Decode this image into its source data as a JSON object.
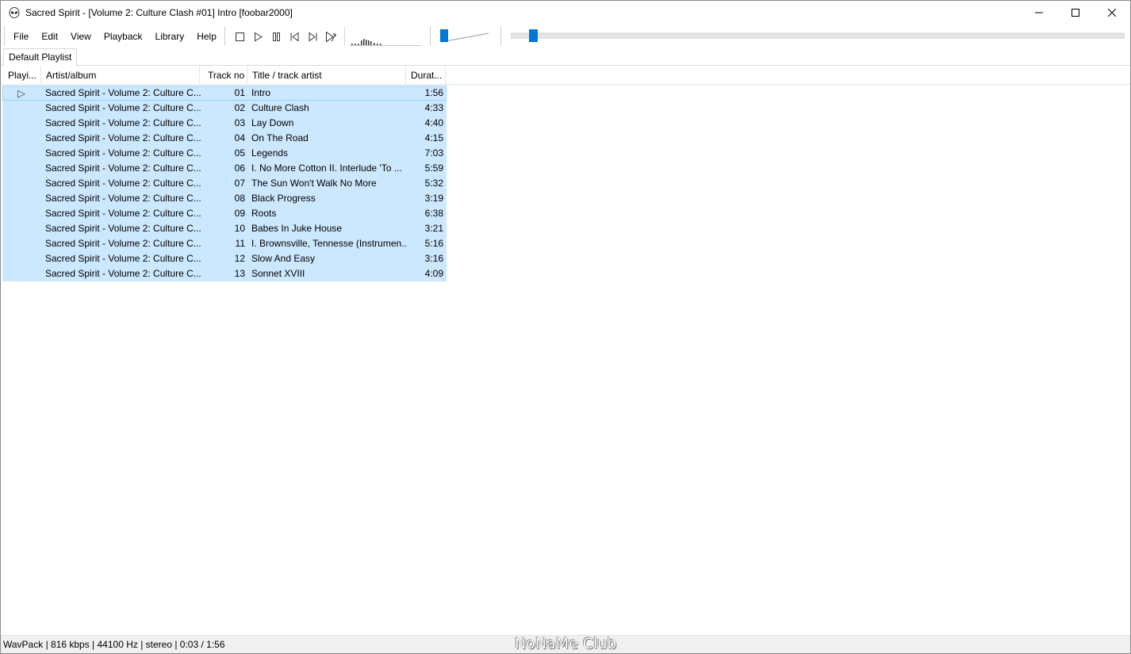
{
  "window": {
    "title": "Sacred Spirit - [Volume 2: Culture Clash #01] Intro  [foobar2000]"
  },
  "menu": [
    "File",
    "Edit",
    "View",
    "Playback",
    "Library",
    "Help"
  ],
  "transport_icons": [
    "stop-icon",
    "play-icon",
    "pause-icon",
    "previous-icon",
    "next-icon",
    "random-icon"
  ],
  "tabs": [
    "Default Playlist"
  ],
  "columns": {
    "playing": "Playi...",
    "artist_album": "Artist/album",
    "track_no": "Track no",
    "title_artist": "Title / track artist",
    "duration": "Durat..."
  },
  "rows": [
    {
      "playing": "▷",
      "artist": "Sacred Spirit - Volume 2: Culture C...",
      "track": "01",
      "title": "Intro",
      "duration": "1:56"
    },
    {
      "playing": "",
      "artist": "Sacred Spirit - Volume 2: Culture C...",
      "track": "02",
      "title": "Culture Clash",
      "duration": "4:33"
    },
    {
      "playing": "",
      "artist": "Sacred Spirit - Volume 2: Culture C...",
      "track": "03",
      "title": "Lay Down",
      "duration": "4:40"
    },
    {
      "playing": "",
      "artist": "Sacred Spirit - Volume 2: Culture C...",
      "track": "04",
      "title": "On The Road",
      "duration": "4:15"
    },
    {
      "playing": "",
      "artist": "Sacred Spirit - Volume 2: Culture C...",
      "track": "05",
      "title": "Legends",
      "duration": "7:03"
    },
    {
      "playing": "",
      "artist": "Sacred Spirit - Volume 2: Culture C...",
      "track": "06",
      "title": "I. No More Cotton II. Interlude 'To ...",
      "duration": "5:59"
    },
    {
      "playing": "",
      "artist": "Sacred Spirit - Volume 2: Culture C...",
      "track": "07",
      "title": "The Sun Won't Walk No More",
      "duration": "5:32"
    },
    {
      "playing": "",
      "artist": "Sacred Spirit - Volume 2: Culture C...",
      "track": "08",
      "title": "Black Progress",
      "duration": "3:19"
    },
    {
      "playing": "",
      "artist": "Sacred Spirit - Volume 2: Culture C...",
      "track": "09",
      "title": "Roots",
      "duration": "6:38"
    },
    {
      "playing": "",
      "artist": "Sacred Spirit - Volume 2: Culture C...",
      "track": "10",
      "title": "Babes In Juke House",
      "duration": "3:21"
    },
    {
      "playing": "",
      "artist": "Sacred Spirit - Volume 2: Culture C...",
      "track": "11",
      "title": "I. Brownsville, Tennesse (Instrumen...",
      "duration": "5:16"
    },
    {
      "playing": "",
      "artist": "Sacred Spirit - Volume 2: Culture C...",
      "track": "12",
      "title": "Slow And Easy",
      "duration": "3:16"
    },
    {
      "playing": "",
      "artist": "Sacred Spirit - Volume 2: Culture C...",
      "track": "13",
      "title": "Sonnet XVIII",
      "duration": "4:09"
    }
  ],
  "status": {
    "text": "WavPack | 816 kbps | 44100 Hz | stereo | 0:03 / 1:56",
    "watermark": "NoNaMe Club"
  },
  "playback": {
    "seek_fraction": 0.03,
    "volume_fraction": 0.05
  },
  "colors": {
    "selection": "#cce8ff",
    "slider_thumb": "#0078d7"
  }
}
